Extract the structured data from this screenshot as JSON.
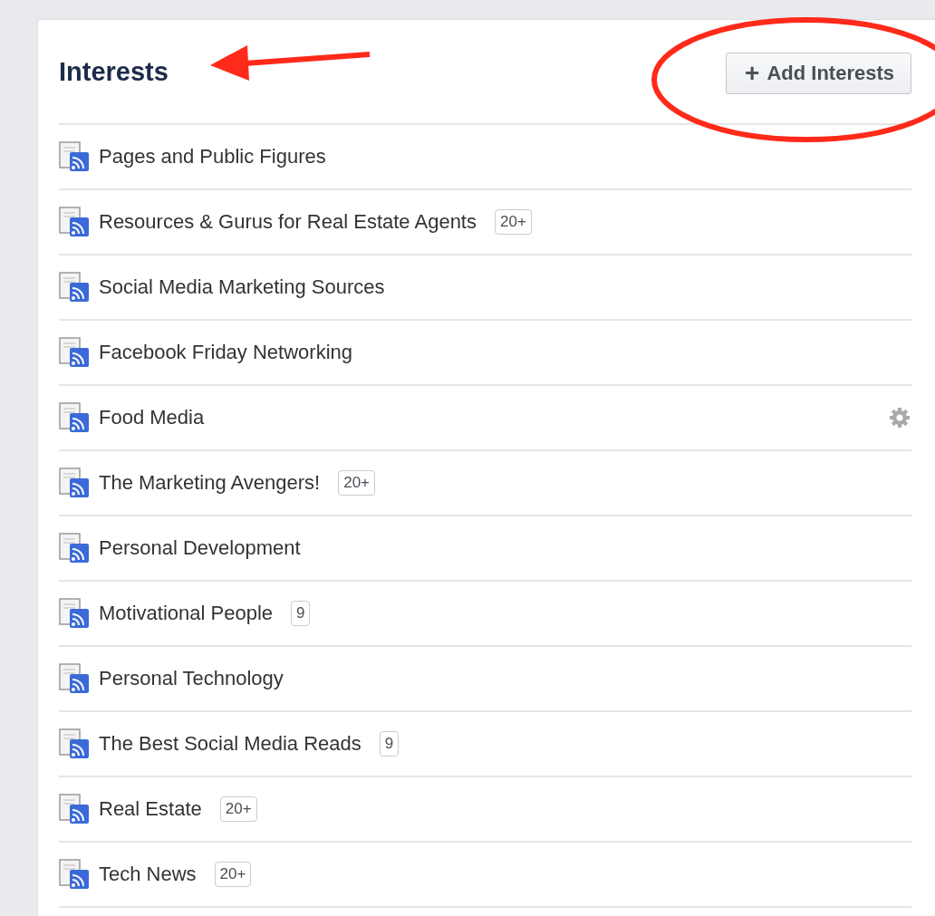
{
  "header": {
    "title": "Interests",
    "button": {
      "icon": "+",
      "label": "Add Interests"
    }
  },
  "items": [
    {
      "label": "Pages and Public Figures",
      "settings": false
    },
    {
      "label": "Resources & Gurus for Real Estate Agents",
      "count": "20+",
      "settings": false
    },
    {
      "label": "Social Media Marketing Sources",
      "settings": false
    },
    {
      "label": "Facebook Friday Networking",
      "settings": false
    },
    {
      "label": "Food Media",
      "settings": true
    },
    {
      "label": "The Marketing Avengers!",
      "count": "20+",
      "settings": false
    },
    {
      "label": "Personal Development",
      "settings": false
    },
    {
      "label": "Motivational People",
      "count": "9",
      "settings": false
    },
    {
      "label": "Personal Technology",
      "settings": false
    },
    {
      "label": "The Best Social Media Reads",
      "count": "9",
      "settings": false
    },
    {
      "label": "Real Estate",
      "count": "20+",
      "settings": false
    },
    {
      "label": "Tech News",
      "count": "20+",
      "settings": false
    }
  ]
}
